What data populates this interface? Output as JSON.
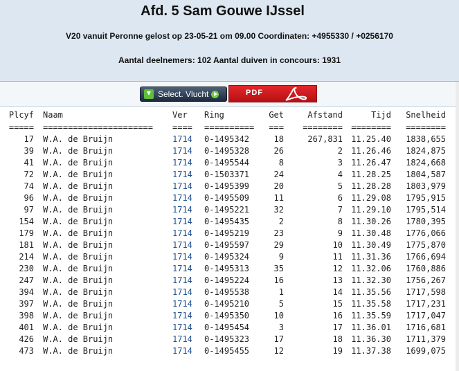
{
  "header": {
    "title": "Afd. 5 Sam Gouwe IJssel",
    "line1": "V20 vanuit Peronne gelost op 23-05-21 om 09.00 Coordinaten: +4955330 / +0256170",
    "line2": "Aantal deelnemers: 102 Aantal duiven in concours: 1931"
  },
  "toolbar": {
    "select_label": "Select. Vlucht",
    "pdf_label": "PDF"
  },
  "table": {
    "columns": [
      "Plcyf",
      "Naam",
      "Ver",
      "Ring",
      "Get",
      "Afstand",
      "Tijd",
      "Snelheid"
    ],
    "separators": [
      "=====",
      "======================",
      "====",
      "==========",
      "===",
      "========",
      "========",
      "========"
    ],
    "rows": [
      [
        "17",
        "W.A. de Bruijn",
        "1714",
        "0-1495342",
        "18",
        "267,831",
        "11.25.40",
        "1838,655"
      ],
      [
        "39",
        "W.A. de Bruijn",
        "1714",
        "0-1495328",
        "26",
        "2",
        "11.26.46",
        "1824,875"
      ],
      [
        "41",
        "W.A. de Bruijn",
        "1714",
        "0-1495544",
        "8",
        "3",
        "11.26.47",
        "1824,668"
      ],
      [
        "72",
        "W.A. de Bruijn",
        "1714",
        "0-1503371",
        "24",
        "4",
        "11.28.25",
        "1804,587"
      ],
      [
        "74",
        "W.A. de Bruijn",
        "1714",
        "0-1495399",
        "20",
        "5",
        "11.28.28",
        "1803,979"
      ],
      [
        "96",
        "W.A. de Bruijn",
        "1714",
        "0-1495509",
        "11",
        "6",
        "11.29.08",
        "1795,915"
      ],
      [
        "97",
        "W.A. de Bruijn",
        "1714",
        "0-1495221",
        "32",
        "7",
        "11.29.10",
        "1795,514"
      ],
      [
        "154",
        "W.A. de Bruijn",
        "1714",
        "0-1495435",
        "2",
        "8",
        "11.30.26",
        "1780,395"
      ],
      [
        "179",
        "W.A. de Bruijn",
        "1714",
        "0-1495219",
        "23",
        "9",
        "11.30.48",
        "1776,066"
      ],
      [
        "181",
        "W.A. de Bruijn",
        "1714",
        "0-1495597",
        "29",
        "10",
        "11.30.49",
        "1775,870"
      ],
      [
        "214",
        "W.A. de Bruijn",
        "1714",
        "0-1495324",
        "9",
        "11",
        "11.31.36",
        "1766,694"
      ],
      [
        "230",
        "W.A. de Bruijn",
        "1714",
        "0-1495313",
        "35",
        "12",
        "11.32.06",
        "1760,886"
      ],
      [
        "247",
        "W.A. de Bruijn",
        "1714",
        "0-1495224",
        "16",
        "13",
        "11.32.30",
        "1756,267"
      ],
      [
        "394",
        "W.A. de Bruijn",
        "1714",
        "0-1495538",
        "1",
        "14",
        "11.35.56",
        "1717,598"
      ],
      [
        "397",
        "W.A. de Bruijn",
        "1714",
        "0-1495210",
        "5",
        "15",
        "11.35.58",
        "1717,231"
      ],
      [
        "398",
        "W.A. de Bruijn",
        "1714",
        "0-1495350",
        "10",
        "16",
        "11.35.59",
        "1717,047"
      ],
      [
        "401",
        "W.A. de Bruijn",
        "1714",
        "0-1495454",
        "3",
        "17",
        "11.36.01",
        "1716,681"
      ],
      [
        "426",
        "W.A. de Bruijn",
        "1714",
        "0-1495323",
        "17",
        "18",
        "11.36.30",
        "1711,379"
      ],
      [
        "473",
        "W.A. de Bruijn",
        "1714",
        "0-1495455",
        "12",
        "19",
        "11.37.38",
        "1699,075"
      ]
    ]
  },
  "colors": {
    "header_bg": "#dde7f1",
    "ver_link": "#1f4f8f",
    "pdf_red": "#d41a1e",
    "select_dark": "#1c2b3d"
  }
}
